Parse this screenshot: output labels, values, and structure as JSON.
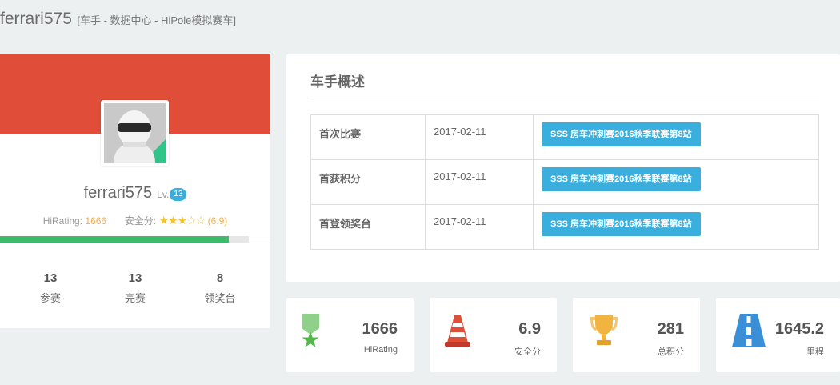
{
  "header": {
    "username": "ferrari575",
    "subtitle": "[车手 - 数据中心 - HiPole模拟赛车]"
  },
  "profile": {
    "avatar_icon": "helmet-avatar",
    "name": "ferrari575",
    "level_prefix": "Lv.",
    "level": "13",
    "hirating_label": "HiRating:",
    "hirating_value": "1666",
    "safety_label": "安全分:",
    "safety_stars_filled": 3,
    "safety_stars_total": 5,
    "safety_value": "(6.9)",
    "progress_fraction": 0.92,
    "colors": {
      "banner": "#e04e3a",
      "progress": "#3dbb6b",
      "level_badge": "#3aafde"
    },
    "stats": [
      {
        "value": "13",
        "label": "参赛"
      },
      {
        "value": "13",
        "label": "完赛"
      },
      {
        "value": "8",
        "label": "领奖台"
      }
    ]
  },
  "overview": {
    "title": "车手概述",
    "rows": [
      {
        "label": "首次比赛",
        "date": "2017-02-11",
        "event": "SSS 房车冲刺赛2016秋季联赛第8站"
      },
      {
        "label": "首获积分",
        "date": "2017-02-11",
        "event": "SSS 房车冲刺赛2016秋季联赛第8站"
      },
      {
        "label": "首登领奖台",
        "date": "2017-02-11",
        "event": "SSS 房车冲刺赛2016秋季联赛第8站"
      }
    ],
    "event_button_color": "#3aafde"
  },
  "metrics": [
    {
      "icon": "ribbon-star-icon",
      "value": "1666",
      "label": "HiRating"
    },
    {
      "icon": "traffic-cone-icon",
      "value": "6.9",
      "label": "安全分"
    },
    {
      "icon": "trophy-icon",
      "value": "281",
      "label": "总积分"
    },
    {
      "icon": "road-icon",
      "value": "1645.2",
      "label": "里程"
    }
  ]
}
